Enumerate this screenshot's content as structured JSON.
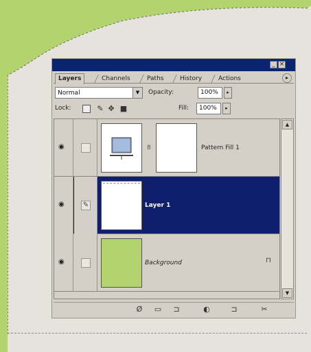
{
  "colors": {
    "titlebar": "#0b2470",
    "selected_layer": "#0f1f6e",
    "fill_green": "#b3d36f",
    "panel": "#d4d0c8"
  },
  "palette": {
    "tabs": [
      "Layers",
      "Channels",
      "Paths",
      "History",
      "Actions"
    ],
    "blend_mode": "Normal",
    "opacity_label": "Opacity:",
    "opacity_value": "100%",
    "lock_label": "Lock:",
    "fill_label": "Fill:",
    "fill_value": "100%",
    "layers": [
      {
        "name": "Pattern Fill 1",
        "selected": false,
        "visible": true
      },
      {
        "name": "Layer 1",
        "selected": true,
        "visible": true
      },
      {
        "name": "Background",
        "selected": false,
        "visible": true,
        "locked": true
      }
    ]
  },
  "icons": {
    "eye": "eye-icon",
    "brush": "brush-icon",
    "lock": "lock-icon",
    "bottom": [
      "layer-style-icon",
      "layer-mask-icon",
      "new-set-icon",
      "adjustment-layer-icon",
      "new-layer-icon",
      "trash-icon"
    ]
  }
}
